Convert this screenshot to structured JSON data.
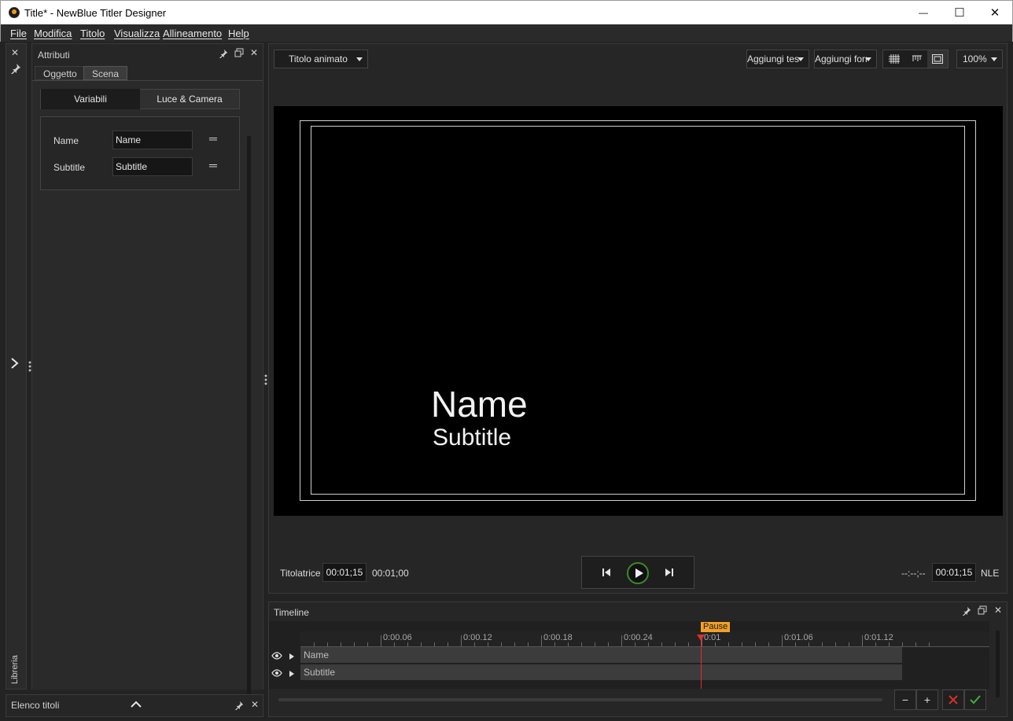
{
  "window": {
    "title": "Title* - NewBlue Titler Designer",
    "minimize": "—",
    "maximize": "☐",
    "close": "✕"
  },
  "menu": {
    "items": [
      "File",
      "Modifica",
      "Titolo",
      "Visualizza",
      "Allineamento",
      "Help"
    ]
  },
  "left_strip": {
    "label": "Libreria"
  },
  "attributes": {
    "title": "Attributi",
    "tabs": [
      "Oggetto",
      "Scena"
    ],
    "active_tab": "Scena",
    "segments": [
      "Variabili",
      "Luce & Camera"
    ],
    "active_segment": "Variabili",
    "variables": [
      {
        "label": "Name",
        "value": "Name"
      },
      {
        "label": "Subtitle",
        "value": "Subtitle"
      }
    ]
  },
  "title_list": {
    "title": "Elenco titoli"
  },
  "preview": {
    "title_type": "Titolo animato",
    "add_text": "Aggiungi testo",
    "add_shape": "Aggiungi forma",
    "zoom": "100%",
    "canvas_name": "Name",
    "canvas_subtitle": "Subtitle",
    "titler_label": "Titolatrice",
    "titler_time": "00:01;15",
    "current_time": "00:01;00",
    "nle_placeholder": "--:--;--",
    "nle_time": "00:01;15",
    "nle_label": "NLE"
  },
  "timeline": {
    "title": "Timeline",
    "ticks": [
      "0:00.06",
      "0:00.12",
      "0:00.18",
      "0:00.24",
      "0:01",
      "0:01.06",
      "0:01.12"
    ],
    "playhead_label": "Pause",
    "tracks": [
      "Name",
      "Subtitle"
    ],
    "zoom_out": "−",
    "zoom_in": "+"
  },
  "colors": {
    "accent": "#f0a02a",
    "playhead": "#d9302c",
    "cancel": "#d9302c",
    "confirm": "#3fae3f",
    "play_ring": "#3a8a2a"
  }
}
